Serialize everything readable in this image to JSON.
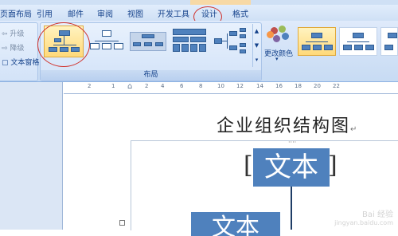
{
  "tabs": [
    {
      "label": "页面布局"
    },
    {
      "label": "引用"
    },
    {
      "label": "邮件"
    },
    {
      "label": "审阅"
    },
    {
      "label": "视图"
    },
    {
      "label": "开发工具"
    },
    {
      "label": "设计"
    },
    {
      "label": "格式"
    }
  ],
  "ribbon": {
    "create_graphic": {
      "promote": "升级",
      "demote": "降级",
      "text_pane": "文本窗格"
    },
    "layouts": {
      "group_label": "布局"
    },
    "smartart_styles": {
      "change_colors": "更改颜色"
    }
  },
  "ruler": {
    "marks": [
      "2",
      "1",
      "2",
      "4",
      "6",
      "8",
      "10",
      "12",
      "14",
      "16",
      "18",
      "20",
      "22"
    ]
  },
  "document": {
    "title": "企业组织结构图",
    "box_top": "文本",
    "box_left": "文本"
  },
  "watermark": {
    "text": "Bai 经验",
    "url": "jingyan.baidu.com"
  },
  "colors": {
    "accent": "#4f81bd",
    "annotation": "#d0302a",
    "ribbon": "#dfeafb"
  }
}
